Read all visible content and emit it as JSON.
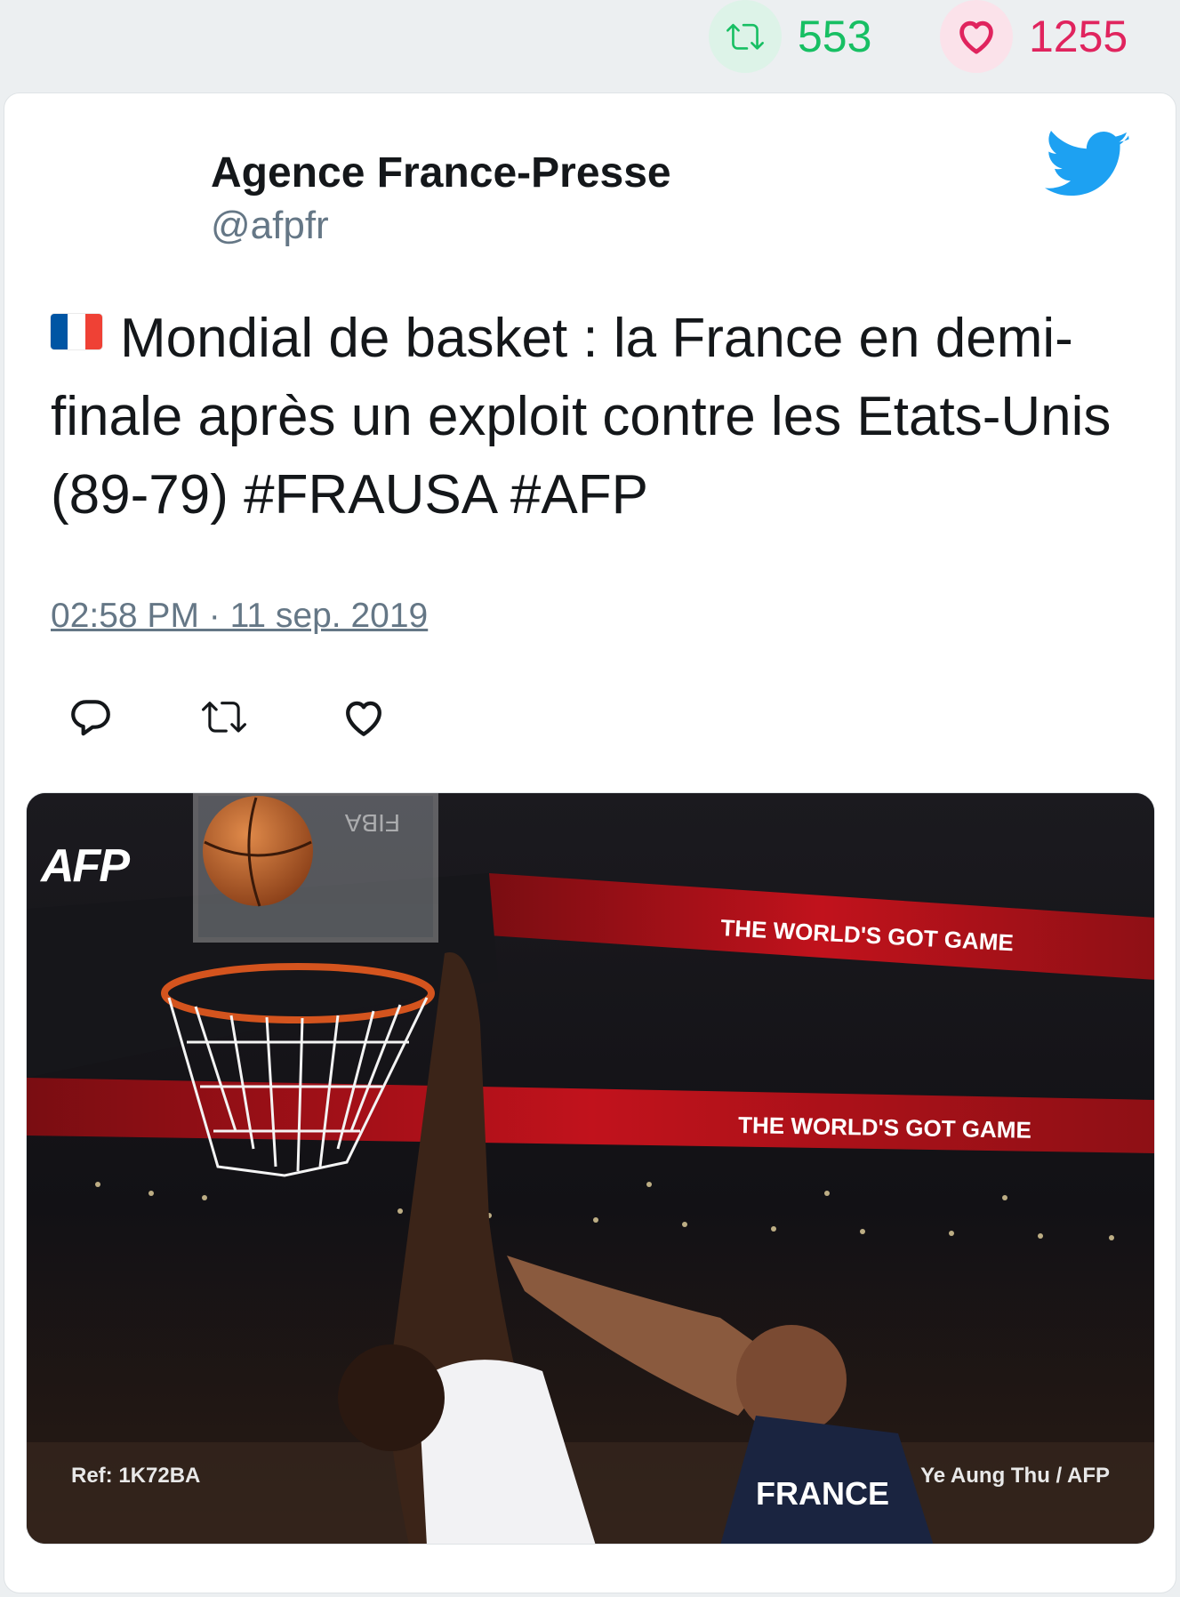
{
  "stats": {
    "retweets": "553",
    "likes": "1255",
    "retweet_icon": "retweet-icon",
    "like_icon": "heart-icon",
    "retweet_color": "#17bf63",
    "like_color": "#e0245e"
  },
  "tweet": {
    "author_name": "Agence France-Presse",
    "author_handle": "@afpfr",
    "flag_icon": "france-flag-icon",
    "text": "Mondial de basket : la France en demi-finale après un exploit contre les Etats-Unis (89-79) #FRAUSA #AFP",
    "timestamp": "02:58 PM · 11 sep. 2019",
    "brand_icon": "twitter-bird-icon",
    "brand_color": "#1da1f2"
  },
  "actions": {
    "reply_icon": "reply-icon",
    "retweet_icon": "retweet-icon",
    "like_icon": "heart-icon"
  },
  "media": {
    "logo_text": "AFP",
    "ref_text": "Ref: 1K72BA",
    "credit_text": "Ye Aung Thu / AFP",
    "banner_text": "THE WORLD'S GOT GAME",
    "backboard_text": "FIBA",
    "jersey_text": "FRANCE"
  }
}
